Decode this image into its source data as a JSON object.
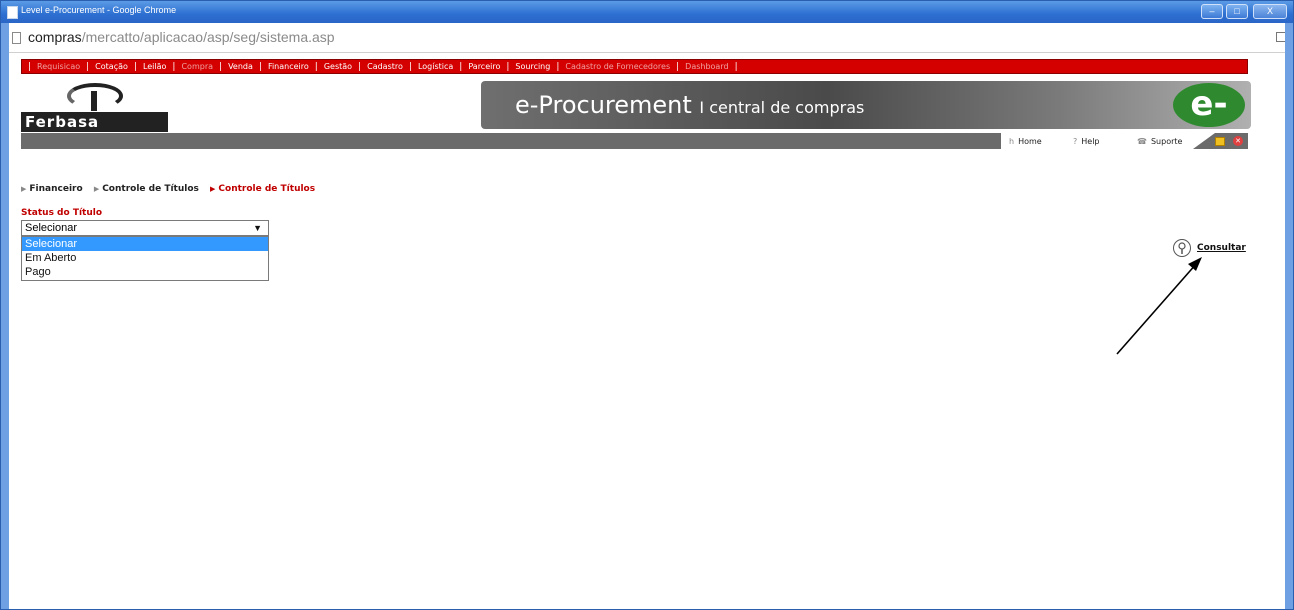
{
  "window": {
    "title": "Level e-Procurement - Google Chrome",
    "controls": {
      "minimize": "–",
      "maximize": "□",
      "close": "X"
    }
  },
  "address": {
    "host": "compras",
    "path": "/mercatto/aplicacao/asp/seg/sistema.asp"
  },
  "menu": {
    "items": [
      {
        "label": "Requisicao",
        "dim": true
      },
      {
        "label": "Cotação",
        "dim": false
      },
      {
        "label": "Leilão",
        "dim": false
      },
      {
        "label": "Compra",
        "dim": true
      },
      {
        "label": "Venda",
        "dim": false
      },
      {
        "label": "Financeiro",
        "dim": false
      },
      {
        "label": "Gestão",
        "dim": false
      },
      {
        "label": "Cadastro",
        "dim": false
      },
      {
        "label": "Logística",
        "dim": false
      },
      {
        "label": "Parceiro",
        "dim": false
      },
      {
        "label": "Sourcing",
        "dim": false
      },
      {
        "label": "Cadastro de Fornecedores",
        "dim": true
      },
      {
        "label": "Dashboard",
        "dim": true
      }
    ]
  },
  "logo": {
    "name": "Ferbasa"
  },
  "banner": {
    "main": "e-Procurement",
    "sub": "I central de compras",
    "badge": "e-"
  },
  "util": {
    "home": "Home",
    "help": "Help",
    "suporte": "Suporte"
  },
  "breadcrumb": {
    "items": [
      "Financeiro",
      "Controle de Títulos"
    ],
    "current": "Controle de Títulos"
  },
  "form": {
    "label": "Status do Título",
    "selected": "Selecionar",
    "options": [
      "Selecionar",
      "Em Aberto",
      "Pago"
    ]
  },
  "consultar": {
    "label": "Consultar"
  }
}
